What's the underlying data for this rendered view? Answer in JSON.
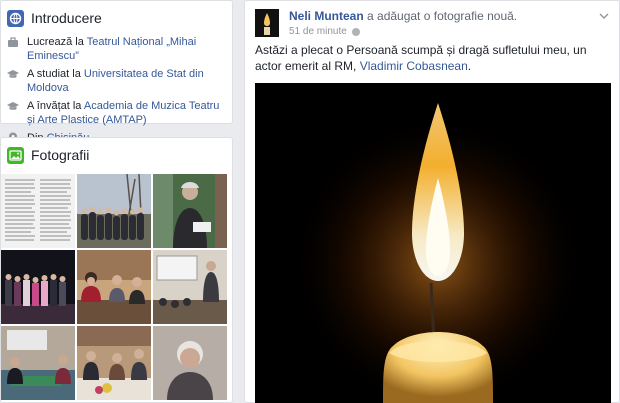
{
  "intro": {
    "title": "Introducere",
    "icon": "globe-icon",
    "items": [
      {
        "icon": "briefcase-icon",
        "prefix": "Lucrează la ",
        "link": "Teatrul Național „Mihai Eminescu”",
        "suffix": ""
      },
      {
        "icon": "graduation-cap-icon",
        "prefix": "A studiat la ",
        "link": "Universitatea de Stat din Moldova",
        "suffix": ""
      },
      {
        "icon": "graduation-cap-icon",
        "prefix": "A învățat la ",
        "link": "Academia de Muzica Teatru și Arte Plastice (AMTAP)",
        "suffix": ""
      },
      {
        "icon": "location-pin-icon",
        "prefix": "Din ",
        "link": "Chișinău",
        "suffix": ""
      }
    ]
  },
  "photos": {
    "title": "Fotografii",
    "icon": "photo-icon",
    "thumbs": [
      {
        "label": "document-photo",
        "bg": "#e8e8e8"
      },
      {
        "label": "group-outdoor-photo",
        "bg": "#7c8aa0"
      },
      {
        "label": "man-speaking-photo",
        "bg": "#3f5a3a"
      },
      {
        "label": "stage-group-photo",
        "bg": "#1a1a22"
      },
      {
        "label": "meeting-photo",
        "bg": "#b89a74"
      },
      {
        "label": "lecture-photo",
        "bg": "#c8c2b8"
      },
      {
        "label": "event-room-photo",
        "bg": "#8a7a6a"
      },
      {
        "label": "table-guests-photo",
        "bg": "#a99178"
      },
      {
        "label": "elderly-woman-photo",
        "bg": "#a09a94"
      }
    ]
  },
  "post": {
    "author": "Neli Muntean",
    "action": " a adăugat o fotografie nouă.",
    "time": "51 de minute",
    "text_before": "Astăzi a plecat o Persoană scumpă și dragă sufletului meu, un actor emerit al RM, ",
    "text_link": "Vladimir Cobasnean",
    "text_after": ".",
    "image_label": "candle-flame-photo"
  },
  "colors": {
    "link": "#365899",
    "background": "#e9ebee",
    "photos_icon": "#42b72a",
    "intro_icon": "#4267b2"
  }
}
